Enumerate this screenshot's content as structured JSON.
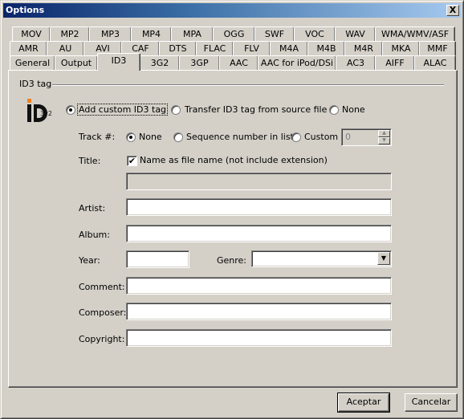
{
  "window": {
    "title": "Options",
    "close_label": "X"
  },
  "tabs": {
    "row1": [
      "MOV",
      "MP2",
      "MP3",
      "MP4",
      "MPA",
      "OGG",
      "SWF",
      "VOC",
      "WAV",
      "WMA/WMV/ASF"
    ],
    "row2": [
      "AMR",
      "AU",
      "AVI",
      "CAF",
      "DTS",
      "FLAC",
      "FLV",
      "M4A",
      "M4B",
      "M4R",
      "MKA",
      "MMF"
    ],
    "row3": [
      "General",
      "Output",
      "ID3",
      "3G2",
      "3GP",
      "AAC",
      "AAC for iPod/DSi",
      "AC3",
      "AIFF",
      "ALAC"
    ],
    "active": "ID3"
  },
  "id3": {
    "group_label": "ID3 tag",
    "logo_icon": "id3v2-logo",
    "logo_text": "3v2",
    "mode_options": [
      {
        "label": "Add custom ID3 tag",
        "checked": true
      },
      {
        "label": "Transfer ID3 tag from source file",
        "checked": false
      },
      {
        "label": "None",
        "checked": false
      }
    ],
    "track": {
      "label": "Track #:",
      "options": [
        {
          "label": "None",
          "checked": true
        },
        {
          "label": "Sequence number in list",
          "checked": false
        },
        {
          "label": "Custom",
          "checked": false
        }
      ],
      "custom_value": "0"
    },
    "title": {
      "label": "Title:",
      "checkbox_label": "Name as file name (not include extension)",
      "checkbox_checked": true,
      "value": ""
    },
    "fields": {
      "artist": {
        "label": "Artist:",
        "value": ""
      },
      "album": {
        "label": "Album:",
        "value": ""
      },
      "year": {
        "label": "Year:",
        "value": ""
      },
      "genre": {
        "label": "Genre:",
        "value": ""
      },
      "comment": {
        "label": "Comment:",
        "value": ""
      },
      "composer": {
        "label": "Composer:",
        "value": ""
      },
      "copyright": {
        "label": "Copyright:",
        "value": ""
      }
    }
  },
  "footer": {
    "ok_label": "Aceptar",
    "cancel_label": "Cancelar"
  },
  "colors": {
    "titlebar_start": "#0a246a",
    "titlebar_end": "#a6caf0",
    "face": "#d4d0c8",
    "logo_orange": "#f08020"
  }
}
